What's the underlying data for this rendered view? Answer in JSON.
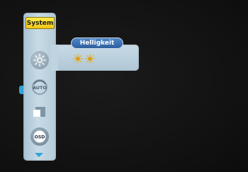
{
  "menu": {
    "section_label": "System",
    "items": [
      {
        "icon": "sun-icon"
      },
      {
        "icon": "auto-icon",
        "label": "AUTO"
      },
      {
        "icon": "square-icon"
      },
      {
        "icon": "osd-icon",
        "label": "OSD"
      }
    ]
  },
  "submenu": {
    "title": "Helligkeit",
    "level_count": 2
  },
  "colors": {
    "panel": "#c8dae6",
    "accent_blue": "#2d5f9f",
    "highlight_yellow": "#f2c619",
    "marker_cyan": "#2fa4d8"
  }
}
